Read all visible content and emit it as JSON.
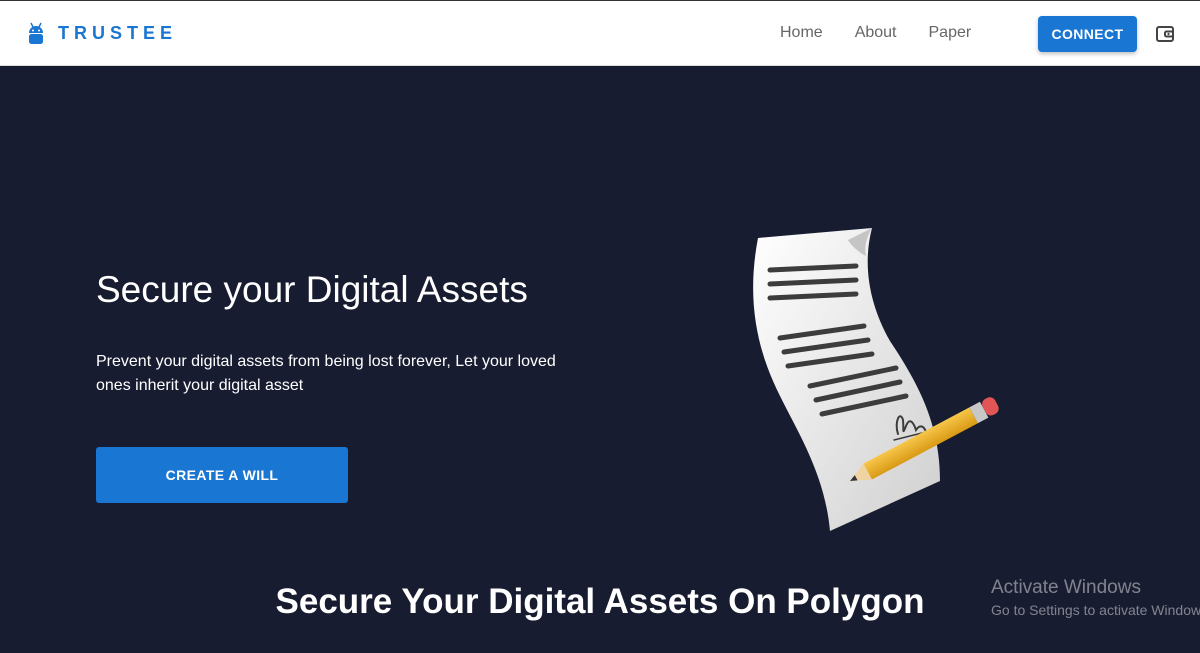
{
  "header": {
    "brand": "TRUSTEE",
    "nav": [
      {
        "label": "Home"
      },
      {
        "label": "About"
      },
      {
        "label": "Paper"
      }
    ],
    "connect_label": "CONNECT"
  },
  "hero": {
    "title": "Secure your Digital Assets",
    "subtitle": "Prevent your digital assets from being lost forever, Let your loved ones inherit your digital asset",
    "cta_label": "CREATE A WILL"
  },
  "section": {
    "title": "Secure Your Digital Assets On Polygon"
  },
  "watermark": {
    "title": "Activate Windows",
    "subtitle": "Go to Settings to activate Windows."
  },
  "icons": {
    "brand": "android-icon",
    "wallet": "wallet-icon",
    "illustration": "document-pencil-illustration"
  },
  "colors": {
    "accent": "#1976d2",
    "hero_background": "#181c30",
    "nav_text": "#666666"
  }
}
